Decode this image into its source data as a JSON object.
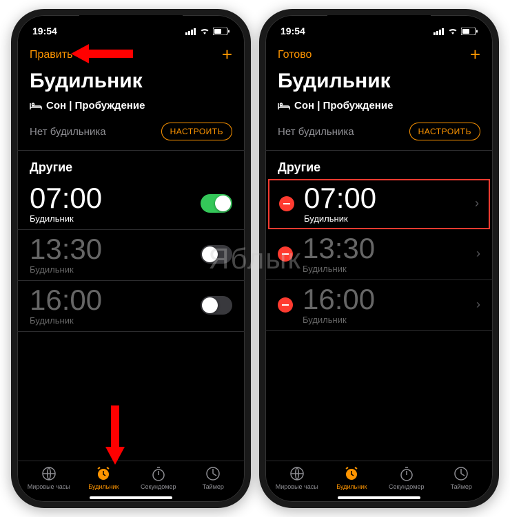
{
  "status": {
    "time": "19:54"
  },
  "left": {
    "nav_left": "Править",
    "nav_plus": "+",
    "title": "Будильник",
    "sleep_label": "Сон | Пробуждение",
    "setup_label": "Нет будильника",
    "setup_btn": "НАСТРОИТЬ",
    "section": "Другие",
    "alarms": [
      {
        "time": "07:00",
        "label": "Будильник",
        "enabled": true
      },
      {
        "time": "13:30",
        "label": "Будильник",
        "enabled": false
      },
      {
        "time": "16:00",
        "label": "Будильник",
        "enabled": false
      }
    ]
  },
  "right": {
    "nav_left": "Готово",
    "nav_plus": "+",
    "title": "Будильник",
    "sleep_label": "Сон | Пробуждение",
    "setup_label": "Нет будильника",
    "setup_btn": "НАСТРОИТЬ",
    "section": "Другие",
    "alarms": [
      {
        "time": "07:00",
        "label": "Будильник",
        "enabled": true
      },
      {
        "time": "13:30",
        "label": "Будильник",
        "enabled": false
      },
      {
        "time": "16:00",
        "label": "Будильник",
        "enabled": false
      }
    ]
  },
  "tabs": {
    "world": "Мировые часы",
    "alarm": "Будильник",
    "stopwatch": "Секундомер",
    "timer": "Таймер"
  },
  "watermark": "Яблык"
}
